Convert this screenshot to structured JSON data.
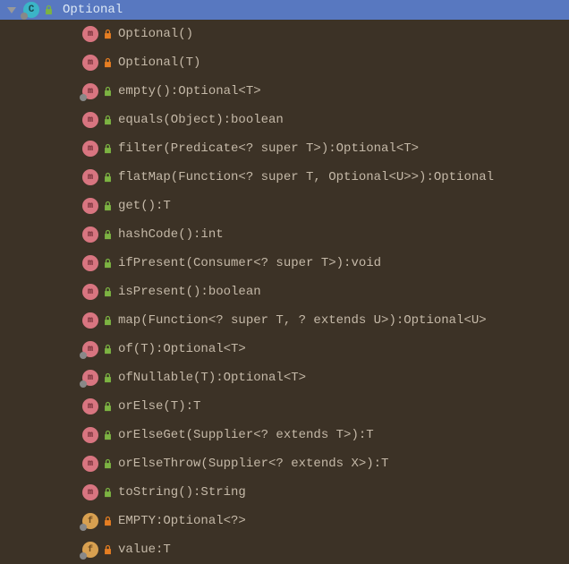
{
  "header": {
    "class_name": "Optional",
    "visibility": "public"
  },
  "members": [
    {
      "type": "method",
      "static": false,
      "visibility": "private",
      "signature": "Optional()"
    },
    {
      "type": "method",
      "static": false,
      "visibility": "private",
      "signature": "Optional(T)"
    },
    {
      "type": "method",
      "static": true,
      "visibility": "public",
      "signature": "empty():Optional<T>"
    },
    {
      "type": "method",
      "static": false,
      "visibility": "public",
      "signature": "equals(Object):boolean"
    },
    {
      "type": "method",
      "static": false,
      "visibility": "public",
      "signature": "filter(Predicate<? super T>):Optional<T>"
    },
    {
      "type": "method",
      "static": false,
      "visibility": "public",
      "signature": "flatMap(Function<? super T, Optional<U>>):Optional"
    },
    {
      "type": "method",
      "static": false,
      "visibility": "public",
      "signature": "get():T"
    },
    {
      "type": "method",
      "static": false,
      "visibility": "public",
      "signature": "hashCode():int"
    },
    {
      "type": "method",
      "static": false,
      "visibility": "public",
      "signature": "ifPresent(Consumer<? super T>):void"
    },
    {
      "type": "method",
      "static": false,
      "visibility": "public",
      "signature": "isPresent():boolean"
    },
    {
      "type": "method",
      "static": false,
      "visibility": "public",
      "signature": "map(Function<? super T, ? extends U>):Optional<U>"
    },
    {
      "type": "method",
      "static": true,
      "visibility": "public",
      "signature": "of(T):Optional<T>"
    },
    {
      "type": "method",
      "static": true,
      "visibility": "public",
      "signature": "ofNullable(T):Optional<T>"
    },
    {
      "type": "method",
      "static": false,
      "visibility": "public",
      "signature": "orElse(T):T"
    },
    {
      "type": "method",
      "static": false,
      "visibility": "public",
      "signature": "orElseGet(Supplier<? extends T>):T"
    },
    {
      "type": "method",
      "static": false,
      "visibility": "public",
      "signature": "orElseThrow(Supplier<? extends X>):T"
    },
    {
      "type": "method",
      "static": false,
      "visibility": "public",
      "signature": "toString():String"
    },
    {
      "type": "field",
      "static": true,
      "visibility": "private",
      "signature": "EMPTY:Optional<?>"
    },
    {
      "type": "field",
      "static": true,
      "visibility": "private",
      "signature": "value:T"
    }
  ],
  "icon_letters": {
    "class": "C",
    "method": "m",
    "field": "f"
  }
}
